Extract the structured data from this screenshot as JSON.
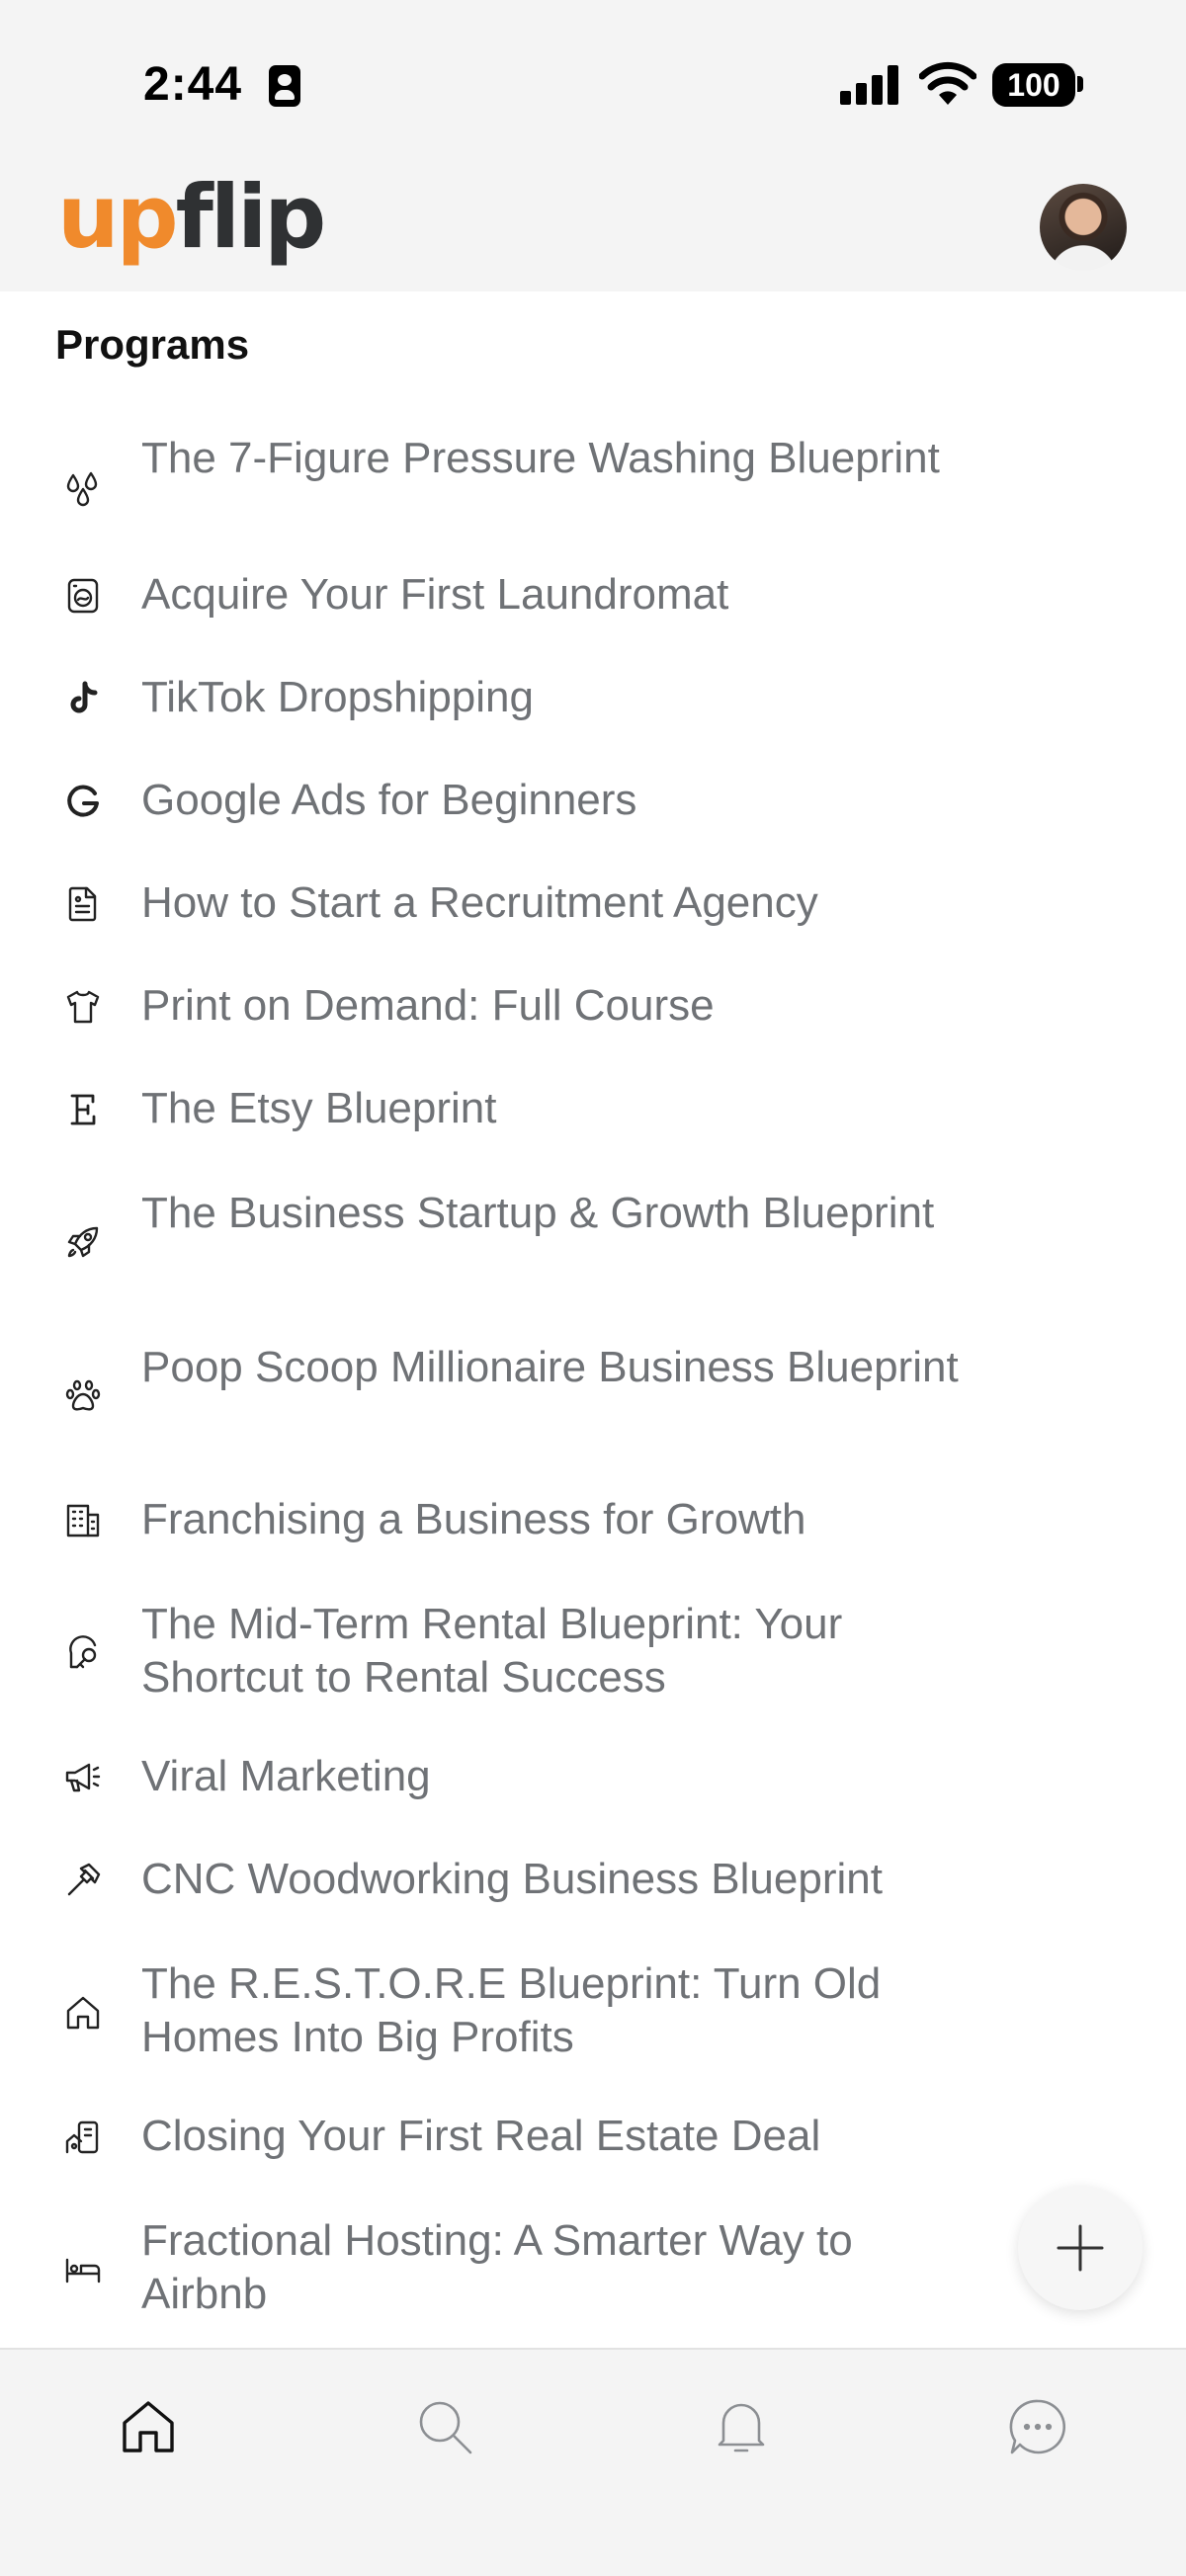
{
  "status_bar": {
    "time": "2:44",
    "battery": "100"
  },
  "header": {
    "logo_part1": "up",
    "logo_part2": "flip",
    "avatar": "profile-avatar"
  },
  "section": {
    "title": "Programs"
  },
  "programs": [
    {
      "label": "The 7-Figure Pressure Washing Blueprint",
      "icon": "droplets-icon"
    },
    {
      "label": "Acquire Your First Laundromat",
      "icon": "washing-machine-icon"
    },
    {
      "label": "TikTok Dropshipping",
      "icon": "tiktok-icon"
    },
    {
      "label": "Google Ads for Beginners",
      "icon": "google-icon"
    },
    {
      "label": "How to Start a Recruitment Agency",
      "icon": "document-icon"
    },
    {
      "label": "Print on Demand: Full Course",
      "icon": "tshirt-icon"
    },
    {
      "label": "The Etsy Blueprint",
      "icon": "etsy-icon"
    },
    {
      "label": "The Business Startup & Growth Blueprint",
      "icon": "rocket-icon"
    },
    {
      "label": "Poop Scoop Millionaire Business Blueprint",
      "icon": "paw-icon"
    },
    {
      "label": "Franchising a Business for Growth",
      "icon": "building-icon"
    },
    {
      "label": "The Mid-Term Rental Blueprint: Your Shortcut to Rental Success",
      "icon": "key-icon"
    },
    {
      "label": "Viral Marketing",
      "icon": "megaphone-icon"
    },
    {
      "label": "CNC Woodworking Business Blueprint",
      "icon": "hammer-icon"
    },
    {
      "label": "The R.E.S.T.O.R.E Blueprint: Turn Old Homes Into Big Profits",
      "icon": "house-icon"
    },
    {
      "label": "Closing Your First Real Estate Deal",
      "icon": "real-estate-icon"
    },
    {
      "label": "Fractional Hosting: A Smarter Way to Airbnb",
      "icon": "bed-icon"
    }
  ],
  "fab": {
    "icon": "plus-icon"
  },
  "tabbar": {
    "tabs": [
      {
        "name": "home",
        "icon": "home-icon",
        "active": true
      },
      {
        "name": "search",
        "icon": "search-icon",
        "active": false
      },
      {
        "name": "notifications",
        "icon": "bell-icon",
        "active": false
      },
      {
        "name": "messages",
        "icon": "chat-icon",
        "active": false
      }
    ]
  },
  "colors": {
    "brand_orange": "#f08a2c",
    "brand_dark": "#2f3133",
    "program_text": "#6f7276",
    "background": "#f4f4f4"
  }
}
